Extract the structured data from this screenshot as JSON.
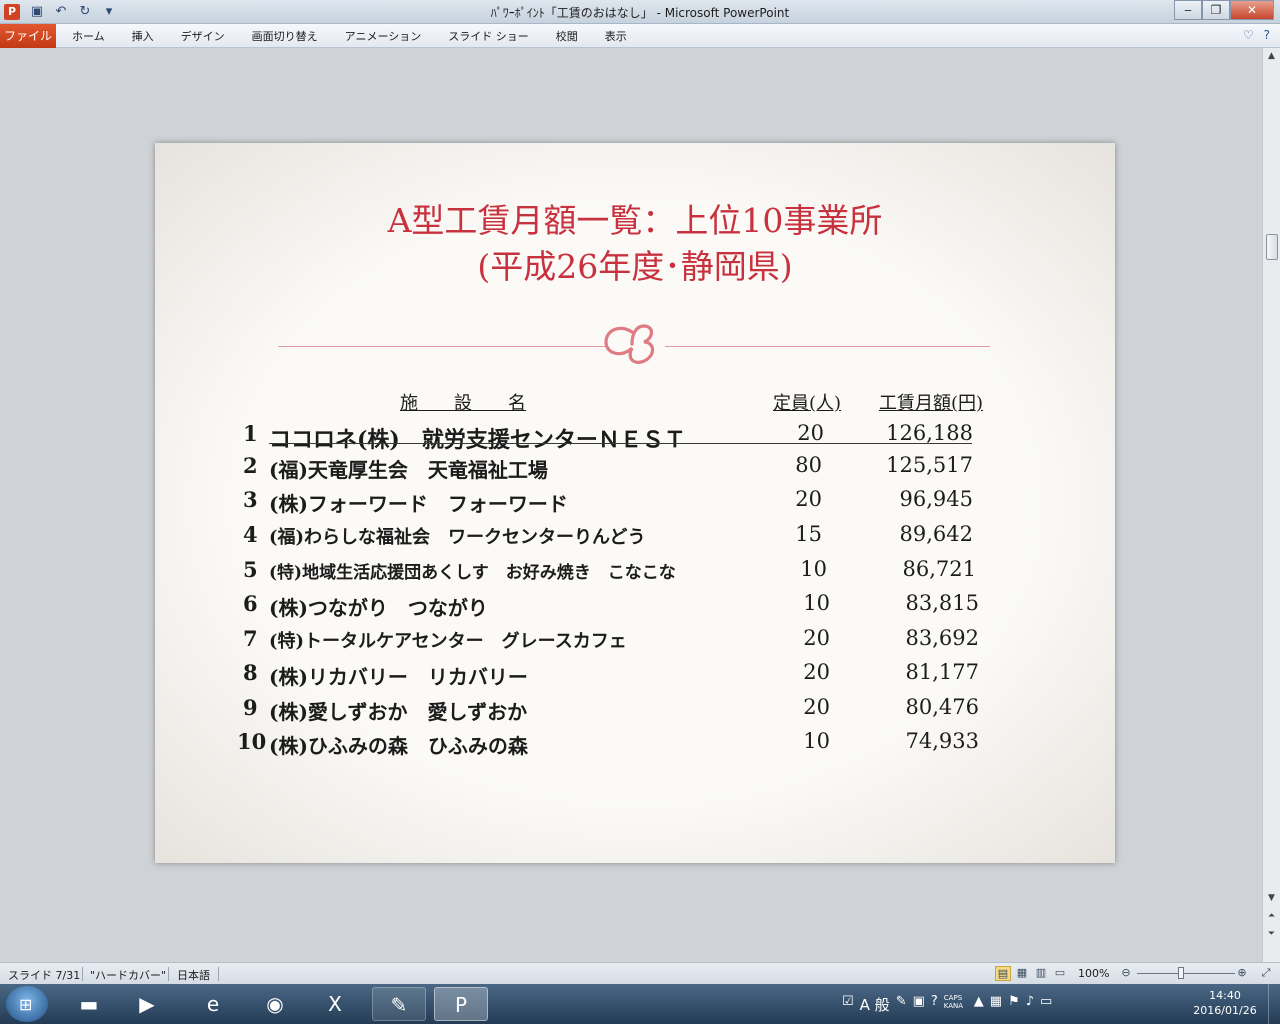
{
  "window": {
    "title": "ﾊﾟﾜｰﾎﾟｲﾝﾄ「工賃のおはなし」 - Microsoft PowerPoint",
    "app_icon": "P",
    "controls": {
      "minimize": "‒",
      "maximize": "❐",
      "close": "✕"
    }
  },
  "ribbon": {
    "file_tab": "ファイル",
    "tabs": [
      "ホーム",
      "挿入",
      "デザイン",
      "画面切り替え",
      "アニメーション",
      "スライド ショー",
      "校閲",
      "表示"
    ]
  },
  "slide": {
    "title_line1": "A型工賃月額一覧：上位10事業所",
    "title_line2": "(平成26年度･静岡県)",
    "columns": {
      "name": "施　　設　　名",
      "capacity": "定員(人)",
      "wage": "工賃月額(円)"
    },
    "rows": [
      {
        "rank": "1",
        "name": "ココロネ(株)　就労支援センターＮＥＳＴ",
        "capacity": "20",
        "wage": "126,188"
      },
      {
        "rank": "2",
        "name": "(福)天竜厚生会　天竜福祉工場",
        "capacity": "80",
        "wage": "125,517"
      },
      {
        "rank": "3",
        "name": "(株)フォーワード　フォーワード",
        "capacity": "20",
        "wage": "96,945"
      },
      {
        "rank": "4",
        "name": "(福)わらしな福祉会　ワークセンターりんどう",
        "capacity": "15",
        "wage": "89,642"
      },
      {
        "rank": "5",
        "name": "(特)地域生活応援団あくしす　お好み焼き　こなこな",
        "capacity": "10",
        "wage": "86,721"
      },
      {
        "rank": "6",
        "name": "(株)つながり　つながり",
        "capacity": "10",
        "wage": "83,815"
      },
      {
        "rank": "7",
        "name": "(特)トータルケアセンター　グレースカフェ",
        "capacity": "20",
        "wage": "83,692"
      },
      {
        "rank": "8",
        "name": "(株)リカバリー　リカバリー",
        "capacity": "20",
        "wage": "81,177"
      },
      {
        "rank": "9",
        "name": "(株)愛しずおか　愛しずおか",
        "capacity": "20",
        "wage": "80,476"
      },
      {
        "rank": "10",
        "name": "(株)ひふみの森　ひふみの森",
        "capacity": "10",
        "wage": "74,933"
      }
    ]
  },
  "statusbar": {
    "slide_pos": "スライド 7/31",
    "theme": "\"ハードカバー\"",
    "language": "日本語",
    "zoom": "100%",
    "zoom_level_percent": 100
  },
  "taskbar": {
    "ime_mode": "A 般",
    "caps": "CAPS",
    "kana": "KANA",
    "time": "14:40",
    "date": "2016/01/26"
  },
  "colors": {
    "title_red": "#c8323f",
    "file_tab": "#c23a14"
  }
}
